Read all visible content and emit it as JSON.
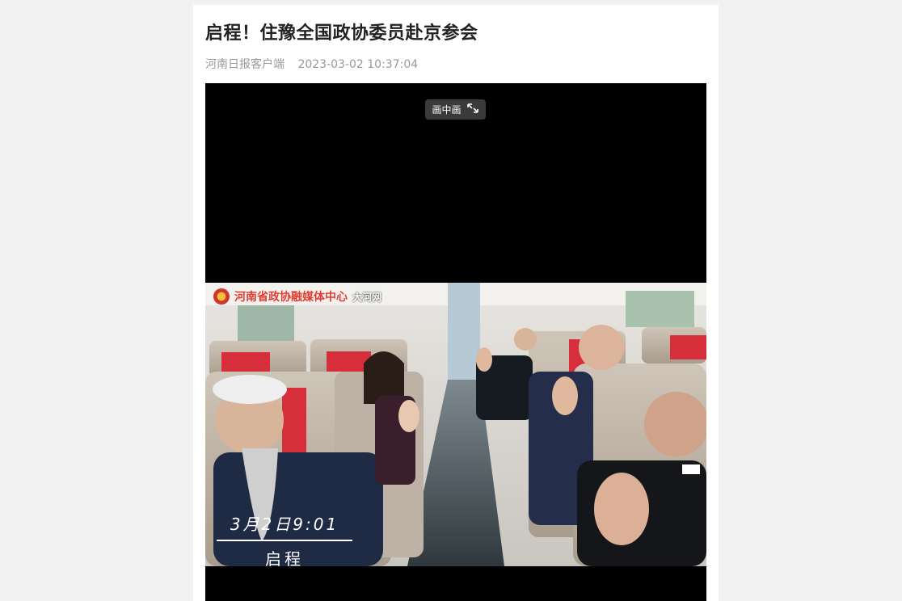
{
  "article": {
    "title": "启程！住豫全国政协委员赴京参会",
    "source": "河南日报客户端",
    "published": "2023-03-02 10:37:04"
  },
  "video": {
    "pip_label": "画中画",
    "pip_icon": "pip-expand-icon",
    "watermark": {
      "org": "河南省政协融媒体中心",
      "partner": "大河网"
    },
    "caption": {
      "date": "3月2日9:01",
      "label": "启程"
    }
  },
  "colors": {
    "page_bg": "#f1f1f1",
    "card_bg": "#ffffff",
    "title": "#222222",
    "meta": "#999999",
    "seat_accent": "#d62e3a"
  }
}
